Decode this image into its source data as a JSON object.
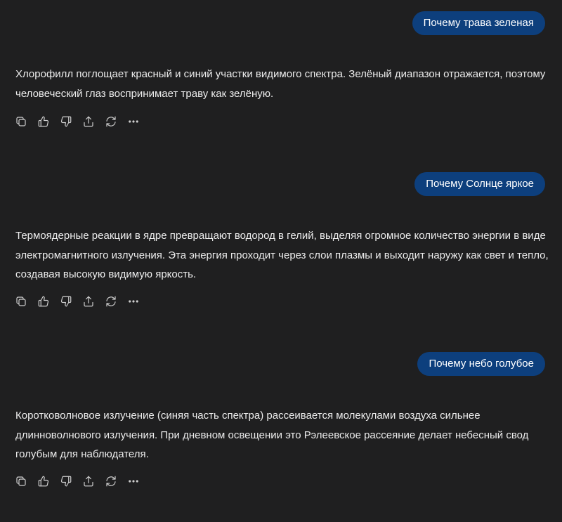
{
  "conversation": [
    {
      "user": "Почему трава зеленая",
      "assistant": "Хлорофилл поглощает красный и синий участки видимого спектра. Зелёный диапазон отражается, поэтому человеческий глаз воспринимает траву как зелёную."
    },
    {
      "user": "Почему Солнце яркое",
      "assistant": "Термоядерные реакции в ядре превращают водород в гелий, выделяя огромное количество энергии в виде электромагнитного излучения. Эта энергия проходит через слои плазмы и выходит наружу как свет и тепло, создавая высокую видимую яркость."
    },
    {
      "user": "Почему небо голубое",
      "assistant": "Коротковолновое излучение (синяя часть спектра) рассеивается молекулами воздуха сильнее длинноволнового излучения. При дневном освещении это Рэлеевское рассеяние делает небесный свод голубым для наблюдателя."
    }
  ],
  "actions": [
    "copy-icon",
    "thumbs-up-icon",
    "thumbs-down-icon",
    "share-icon",
    "regenerate-icon",
    "more-icon"
  ],
  "colors": {
    "background": "#1f1f20",
    "user_bubble": "#0d3f7d",
    "text": "#ececec",
    "icon": "#cfcfcf"
  }
}
